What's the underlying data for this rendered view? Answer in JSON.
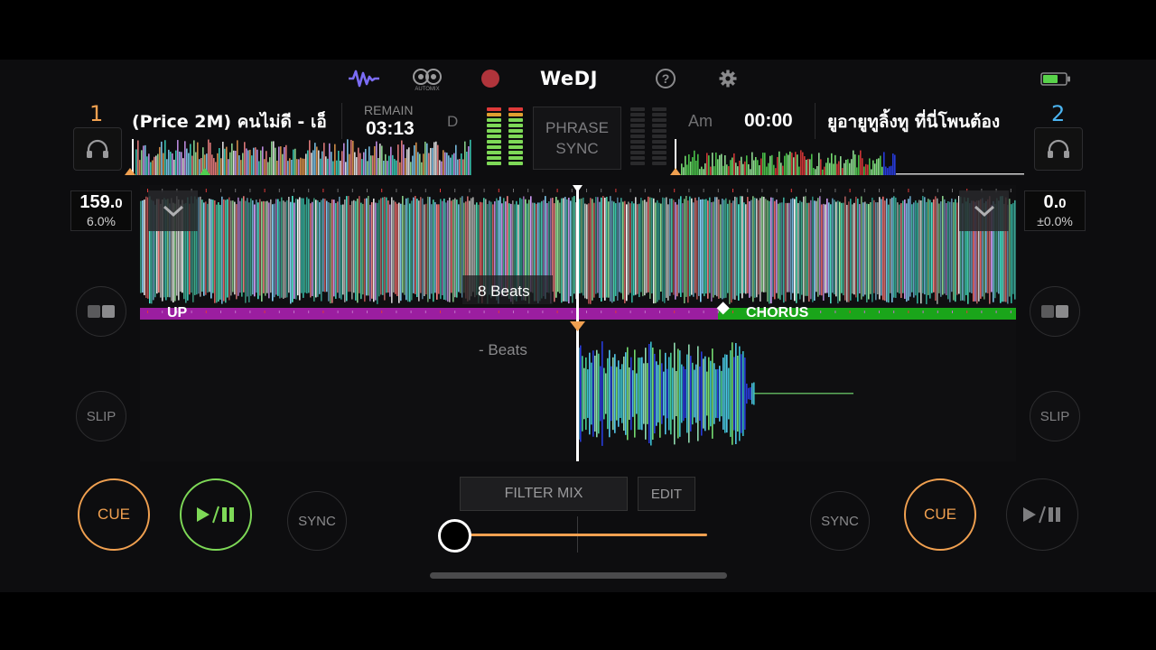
{
  "app": {
    "name": "WeDJ",
    "automix_label": "AUTOMIX"
  },
  "colors": {
    "accent_orange": "#f0a050",
    "accent_green": "#7ed957",
    "deck2_blue": "#4bb3f0",
    "phrase_purple": "#9b1ea0",
    "phrase_green": "#1aa51a",
    "record_red": "#b0343b"
  },
  "toolbar": {
    "icons": [
      "waveform-icon",
      "automix-icon",
      "record-icon",
      "help-icon",
      "settings-icon",
      "battery-icon"
    ]
  },
  "deck1": {
    "number": "1",
    "title": "(Price 2M) คนไม่ดี - เอ็",
    "remain_label": "REMAIN",
    "remain_time": "03:13",
    "key": "D",
    "bpm": "159.",
    "bpm_decimal": "0",
    "pitch": "6.0%",
    "cue_label": "CUE",
    "sync_label": "SYNC",
    "slip_label": "SLIP",
    "play_state": "playing"
  },
  "deck2": {
    "number": "2",
    "title": "ยูอายูทูลิ้งทู ที่นี่โพนต้อง",
    "key": "Am",
    "time": "00:00",
    "bpm": "0.",
    "bpm_decimal": "0",
    "pitch": "±0.0%",
    "cue_label": "CUE",
    "sync_label": "SYNC",
    "slip_label": "SLIP",
    "play_state": "stopped"
  },
  "center": {
    "phrase_sync_line1": "PHRASE",
    "phrase_sync_line2": "SYNC",
    "filter_mix_label": "FILTER MIX",
    "edit_label": "EDIT",
    "crossfader_position": 0.0
  },
  "wave": {
    "beats_label_top": "8 Beats",
    "beats_label_bottom": "- Beats",
    "phrase_left": "UP",
    "phrase_right": "CHORUS"
  }
}
